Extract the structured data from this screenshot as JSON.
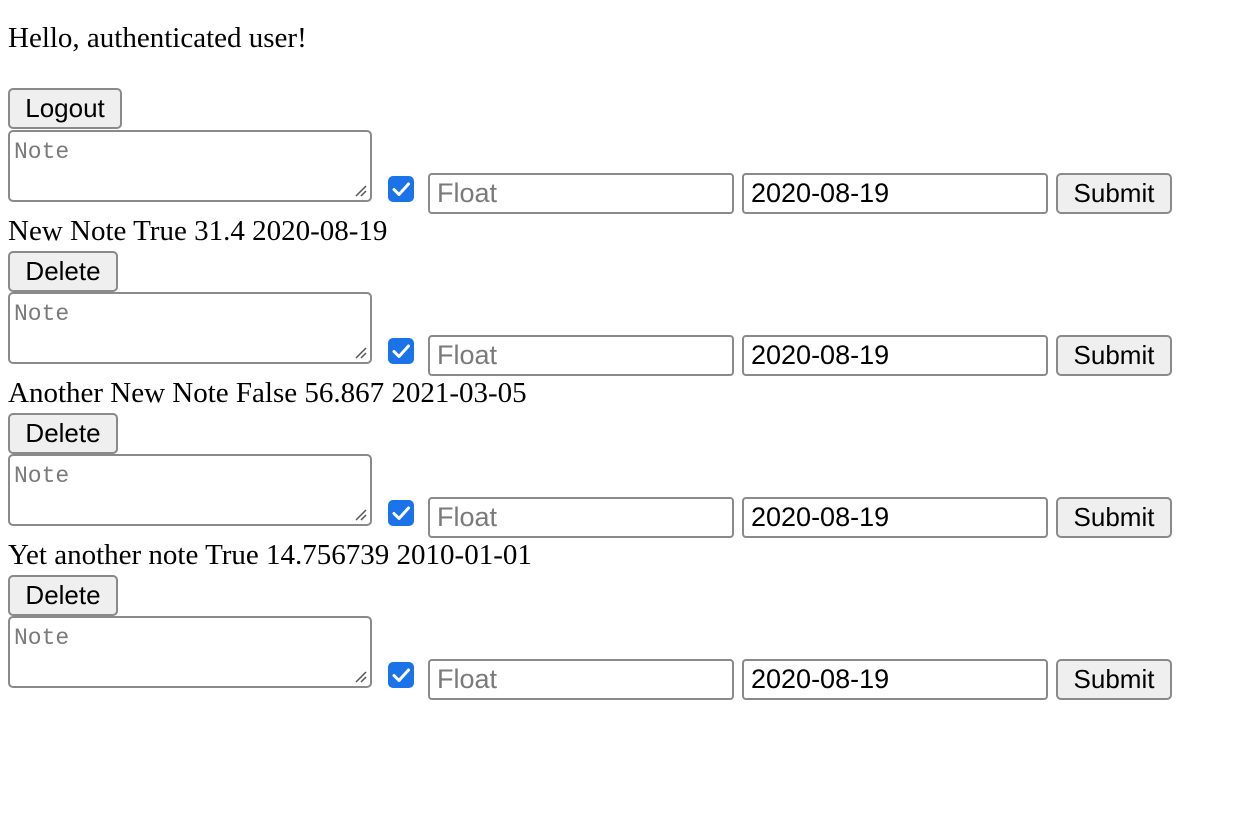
{
  "greeting": "Hello, authenticated user!",
  "logout_label": "Logout",
  "delete_label": "Delete",
  "form": {
    "note_placeholder": "Note",
    "float_placeholder": "Float",
    "date_value": "2020-08-19",
    "submit_label": "Submit",
    "checkbox_checked": true
  },
  "notes": [
    {
      "text": "New Note True 31.4 2020-08-19"
    },
    {
      "text": "Another New Note False 56.867 2021-03-05"
    },
    {
      "text": "Yet another note True 14.756739 2010-01-01"
    }
  ],
  "colors": {
    "checkbox_accent": "#1a73e8",
    "button_bg": "#efefef",
    "border": "#8a8a8a",
    "placeholder": "#7a7a7a"
  }
}
